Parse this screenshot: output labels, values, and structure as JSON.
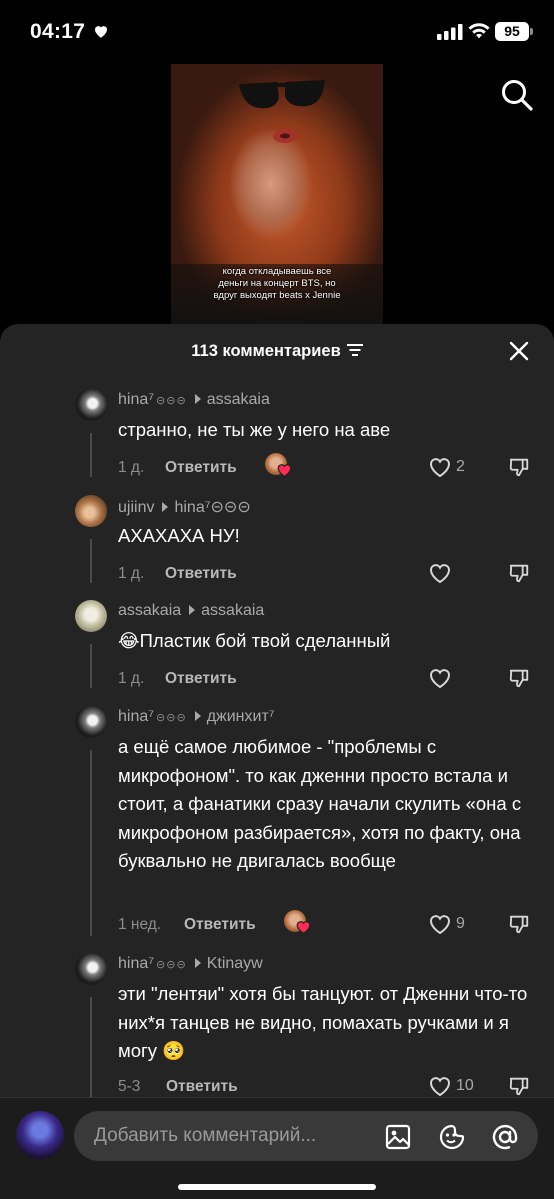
{
  "status_bar": {
    "time": "04:17",
    "battery": "95"
  },
  "video": {
    "caption_lines": [
      "когда откладываешь все",
      "деньги на концерт BTS, но",
      "вдруг выходят beats x Jennie"
    ]
  },
  "comments_header": {
    "title": "113 комментариев"
  },
  "comments": [
    {
      "author": "hina⁷",
      "badge": "⊝⊝⊝",
      "reply_to": "assakaia",
      "text": "странно, не ты же у него на аве",
      "date": "1 д.",
      "reply_label": "Ответить",
      "creator_liked": true,
      "likes": "2"
    },
    {
      "author": "ujiinv",
      "badge": "",
      "reply_to": "hina⁷⊝⊝⊝",
      "text": "АХАХАХА НУ!",
      "date": "1 д.",
      "reply_label": "Ответить",
      "creator_liked": false,
      "likes": ""
    },
    {
      "author": "assakaia",
      "badge": "",
      "reply_to": "assakaia",
      "text": "😂Пластик бой твой сделанный",
      "date": "1 д.",
      "reply_label": "Ответить",
      "creator_liked": false,
      "likes": ""
    },
    {
      "author": "hina⁷",
      "badge": "⊝⊝⊝",
      "reply_to": "джинхит⁷",
      "text": "а ещё самое любимое - \"проблемы с микрофоном\". то как дженни просто встала и стоит, а фанатики сразу начали скулить «она с микрофоном разбирается», хотя по факту, она буквально не двигалась вообще",
      "date": "1 нед.",
      "reply_label": "Ответить",
      "creator_liked": true,
      "likes": "9"
    },
    {
      "author": "hina⁷",
      "badge": "⊝⊝⊝",
      "reply_to": "Ktinayw",
      "text": "эти \"лентяи\" хотя бы танцуют. от Дженни что-то них*я танцев не видно, помахать ручками и я могу 🥺",
      "date": "5-3",
      "reply_label": "Ответить",
      "creator_liked": false,
      "likes": "10"
    }
  ],
  "composer": {
    "placeholder": "Добавить комментарий..."
  },
  "colors": {
    "sheet_bg": "#242424",
    "like_red": "#fe2c55",
    "muted_text": "#a9a9a9"
  }
}
